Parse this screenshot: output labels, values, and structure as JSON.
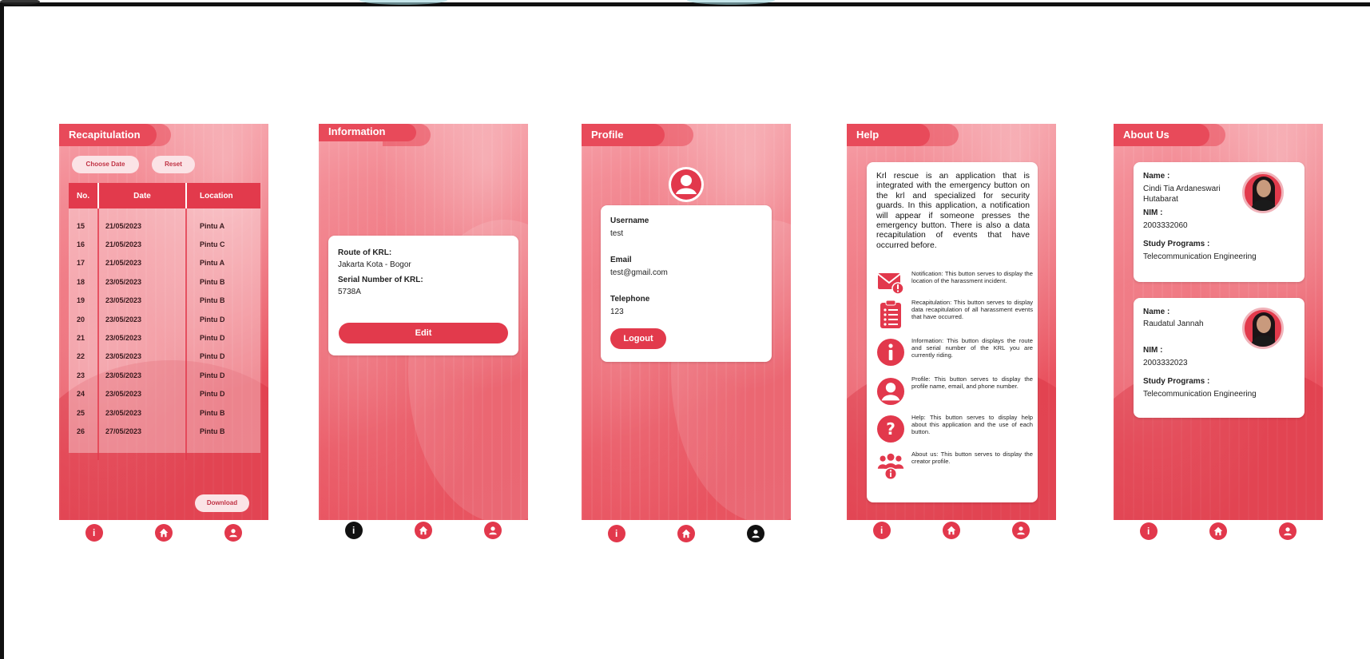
{
  "colors": {
    "accent": "#e23a4c",
    "card": "#ffffff",
    "active_nav": "#111111"
  },
  "nav": {
    "icons": [
      "info-icon",
      "home-icon",
      "user-icon"
    ]
  },
  "recap": {
    "title": "Recapitulation",
    "choose_date": "Choose Date",
    "reset": "Reset",
    "columns": [
      "No.",
      "Date",
      "Location"
    ],
    "rows": [
      [
        "15",
        "21/05/2023",
        "Pintu A"
      ],
      [
        "16",
        "21/05/2023",
        "Pintu C"
      ],
      [
        "17",
        "21/05/2023",
        "Pintu A"
      ],
      [
        "18",
        "23/05/2023",
        "Pintu B"
      ],
      [
        "19",
        "23/05/2023",
        "Pintu B"
      ],
      [
        "20",
        "23/05/2023",
        "Pintu D"
      ],
      [
        "21",
        "23/05/2023",
        "Pintu D"
      ],
      [
        "22",
        "23/05/2023",
        "Pintu D"
      ],
      [
        "23",
        "23/05/2023",
        "Pintu D"
      ],
      [
        "24",
        "23/05/2023",
        "Pintu D"
      ],
      [
        "25",
        "23/05/2023",
        "Pintu B"
      ],
      [
        "26",
        "27/05/2023",
        "Pintu B"
      ]
    ],
    "download": "Download"
  },
  "information": {
    "title": "Information",
    "route_label": "Route of KRL:",
    "route_value": "Jakarta Kota - Bogor",
    "serial_label": "Serial Number of KRL:",
    "serial_value": "5738A",
    "edit": "Edit"
  },
  "profile": {
    "title": "Profile",
    "username_label": "Username",
    "username_value": "test",
    "email_label": "Email",
    "email_value": "test@gmail.com",
    "telephone_label": "Telephone",
    "telephone_value": "123",
    "logout": "Logout"
  },
  "help": {
    "title": "Help",
    "intro": "Krl rescue is an application that is integrated with the emergency button on the krl and specialized for security guards. In this application, a notification will appear if someone presses the emergency button. There is also a data recapitulation of events that have occurred before.",
    "items": [
      {
        "icon": "mail-alert-icon",
        "text": "Notification: This button serves to display the location of the harassment incident."
      },
      {
        "icon": "clipboard-icon",
        "text": "Recapitulation: This button serves to display data recapitulation of all harassment events that have occurred."
      },
      {
        "icon": "info-icon",
        "text": "Information: This button displays the route and serial number of the KRL you are currently riding."
      },
      {
        "icon": "user-icon",
        "text": "Profile: This button serves to display the profile name, email, and phone number."
      },
      {
        "icon": "help-icon",
        "text": "Help: This button serves to display help about this application and the use of each button."
      },
      {
        "icon": "group-icon",
        "text": "About us: This button serves to display the creator profile."
      }
    ]
  },
  "about": {
    "title": "About Us",
    "members": [
      {
        "name_label": "Name :",
        "name": "Cindi Tia Ardaneswari Hutabarat",
        "nim_label": "NIM :",
        "nim": "2003332060",
        "program_label": "Study Programs :",
        "program": "Telecommunication Engineering"
      },
      {
        "name_label": "Name :",
        "name": "Raudatul Jannah",
        "nim_label": "NIM :",
        "nim": "2003332023",
        "program_label": "Study Programs :",
        "program": "Telecommunication Engineering"
      }
    ]
  }
}
